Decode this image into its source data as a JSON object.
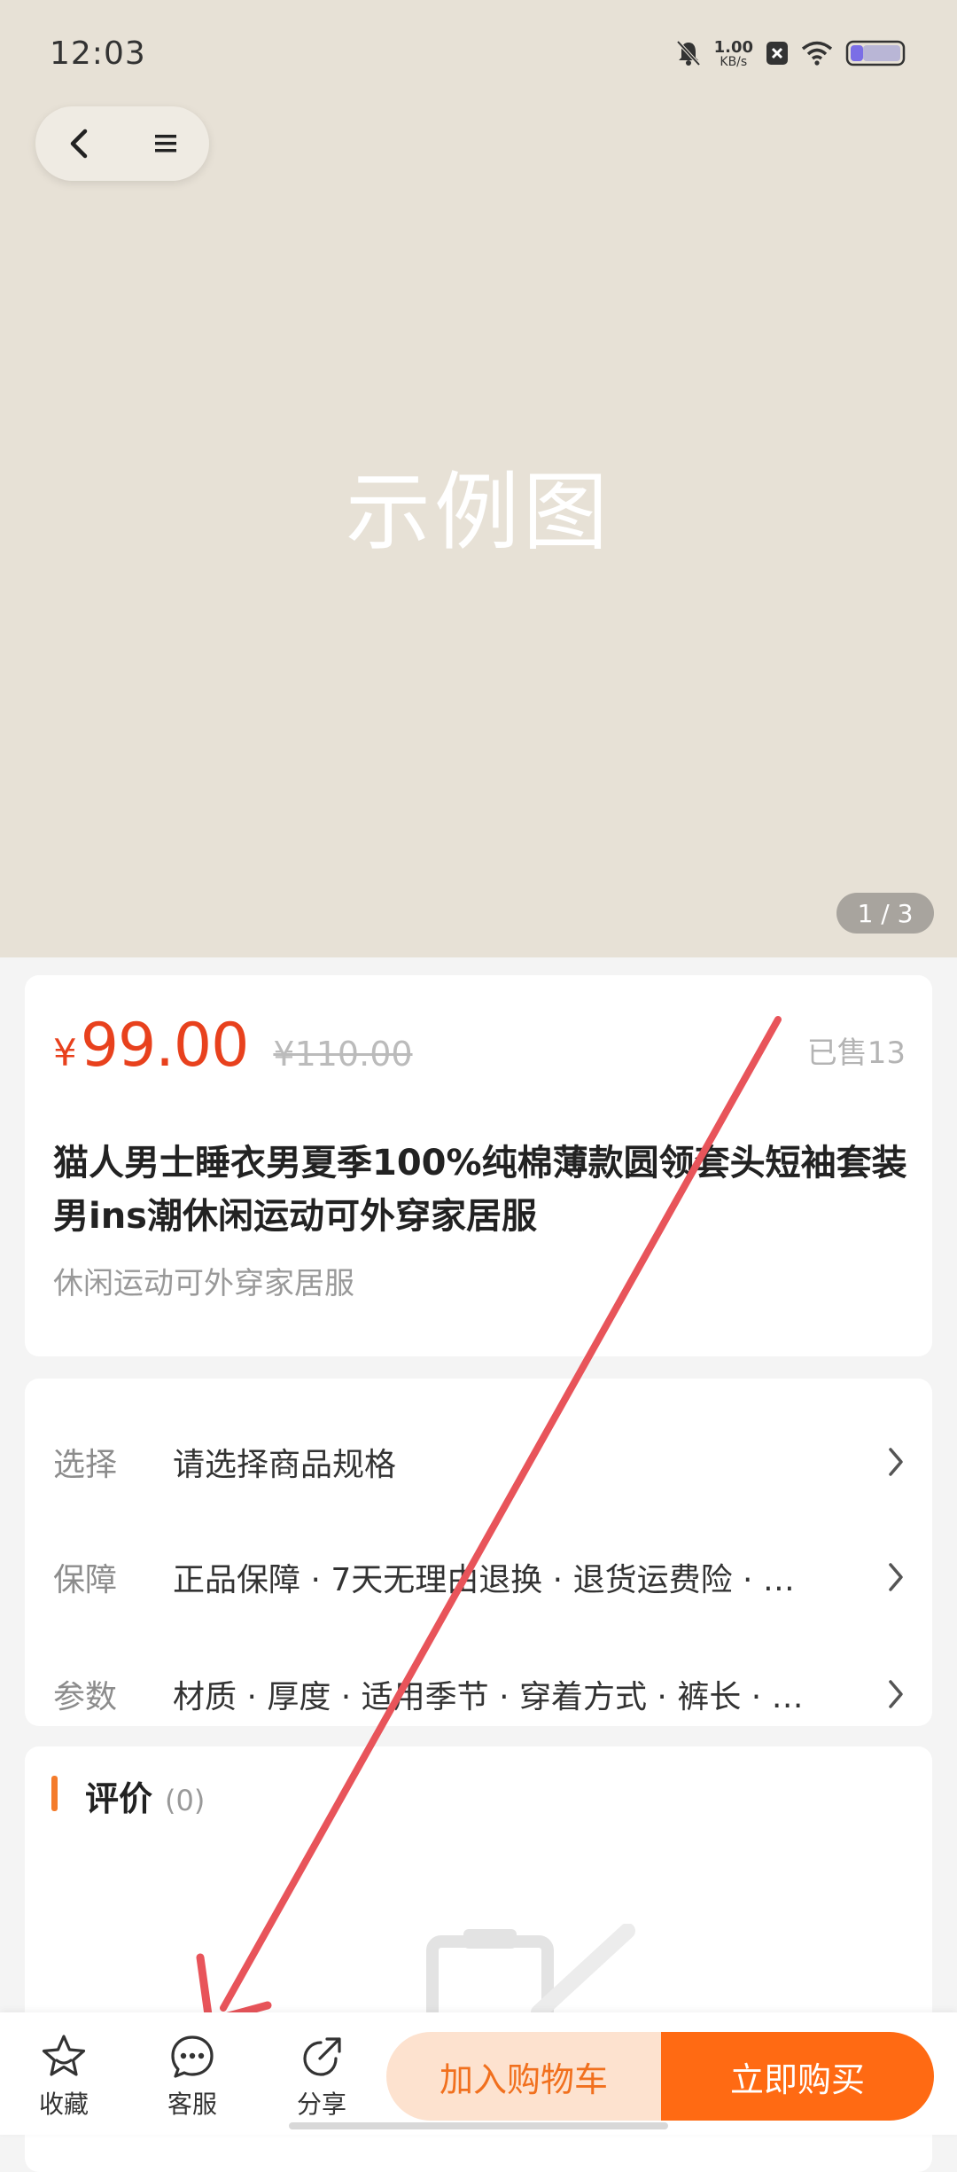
{
  "status_bar": {
    "time": "12:03",
    "net_speed_value": "1.00",
    "net_speed_unit": "KB/s",
    "icons": [
      "bell-off-icon",
      "close-icon",
      "wifi-icon",
      "battery-icon"
    ]
  },
  "hero": {
    "watermark": "示例图",
    "page_indicator": "1 / 3",
    "background_color": "#e7e1d6"
  },
  "product": {
    "currency": "¥",
    "price": "99.00",
    "original_price": "¥110.00",
    "sold": "已售13",
    "title": "猫人男士睡衣男夏季100%纯棉薄款圆领套头短袖套装男ins潮休闲运动可外穿家居服",
    "subtitle": "休闲运动可外穿家居服"
  },
  "specs": [
    {
      "label": "选择",
      "value": "请选择商品规格"
    },
    {
      "label": "保障",
      "value": "正品保障 · 7天无理由退换 · 退货运费险 · …"
    },
    {
      "label": "参数",
      "value": "材质 · 厚度 · 适用季节 · 穿着方式 · 裤长 · …"
    }
  ],
  "reviews": {
    "title": "评价",
    "count": "(0)"
  },
  "bottom_bar": {
    "favorite": "收藏",
    "service": "客服",
    "share": "分享",
    "add_to_cart": "加入购物车",
    "buy_now": "立即购买"
  },
  "colors": {
    "accent": "#ff6a13",
    "price": "#e8411d",
    "annotation_arrow": "#e8545a"
  }
}
